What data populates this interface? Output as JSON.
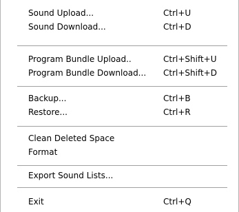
{
  "menu": {
    "items": [
      {
        "label": "Sound Upload...",
        "shortcut": "Ctrl+U"
      },
      {
        "label": "Sound Download...",
        "shortcut": "Ctrl+D"
      },
      {
        "label": "Program Bundle Upload..",
        "shortcut": "Ctrl+Shift+U"
      },
      {
        "label": "Program Bundle Download...",
        "shortcut": "Ctrl+Shift+D"
      },
      {
        "label": "Backup...",
        "shortcut": "Ctrl+B"
      },
      {
        "label": "Restore...",
        "shortcut": "Ctrl+R"
      },
      {
        "label": "Clean Deleted Space",
        "shortcut": ""
      },
      {
        "label": "Format",
        "shortcut": ""
      },
      {
        "label": "Export Sound Lists...",
        "shortcut": ""
      },
      {
        "label": "Exit",
        "shortcut": "Ctrl+Q"
      }
    ]
  }
}
